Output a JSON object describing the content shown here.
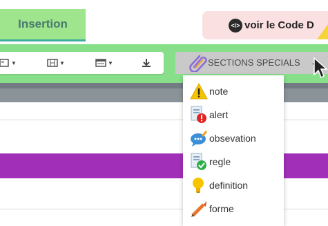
{
  "tabs": {
    "insertion_label": "Insertion"
  },
  "code_button": {
    "label": "voir le Code D",
    "icon_text": "</>"
  },
  "toolbar": {
    "buttons": [
      {
        "name": "paragraph-format-button"
      },
      {
        "name": "media-button"
      },
      {
        "name": "table-button"
      },
      {
        "name": "download-button"
      }
    ]
  },
  "sections_menu": {
    "label": "SECTIONS SPECIALS",
    "items": [
      {
        "label": "note",
        "icon": "warning-icon"
      },
      {
        "label": "alert",
        "icon": "alert-doc-icon"
      },
      {
        "label": "obsevation",
        "icon": "speech-bubble-icon"
      },
      {
        "label": "regle",
        "icon": "checked-doc-icon"
      },
      {
        "label": "definition",
        "icon": "lightbulb-icon"
      },
      {
        "label": "forme",
        "icon": "pencil-icon"
      }
    ]
  },
  "colors": {
    "tab_green": "#9ee58e",
    "toolbar_band": "#88df8a",
    "purple_band": "#a22fb8",
    "code_button_bg": "#fbe0e2"
  }
}
